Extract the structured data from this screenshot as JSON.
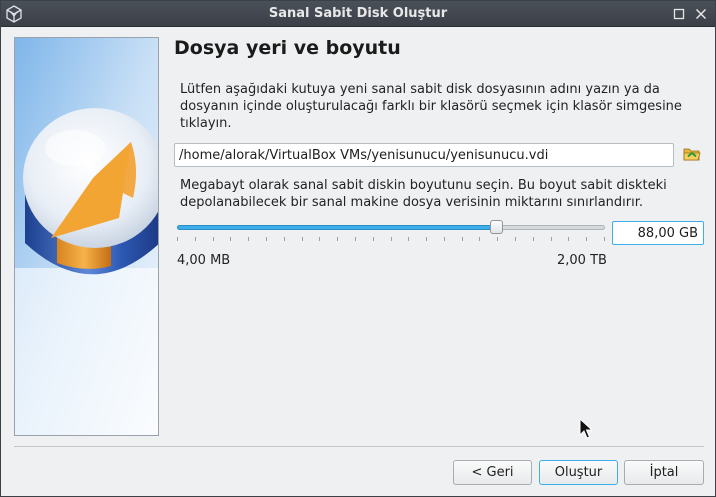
{
  "window": {
    "title": "Sanal Sabit Disk Oluştur"
  },
  "heading": "Dosya yeri ve boyutu",
  "location": {
    "description": "Lütfen aşağıdaki kutuya yeni sanal sabit disk dosyasının adını yazın ya da dosyanın içinde oluşturulacağı farklı bir klasörü seçmek için klasör simgesine tıklayın.",
    "path_value": "/home/alorak/VirtualBox VMs/yenisunucu/yenisunucu.vdi"
  },
  "size": {
    "description": "Megabayt olarak sanal sabit diskin boyutunu seçin. Bu boyut sabit diskteki depolanabilecek bir sanal makine dosya verisinin miktarını sınırlandırır.",
    "value": "88,00 GB",
    "min_label": "4,00 MB",
    "max_label": "2,00 TB",
    "slider_fraction": 0.745
  },
  "buttons": {
    "back": "< Geri",
    "create": "Oluştur",
    "cancel": "İptal"
  },
  "colors": {
    "accent": "#3daee9",
    "titlebar": "#3b4048"
  }
}
